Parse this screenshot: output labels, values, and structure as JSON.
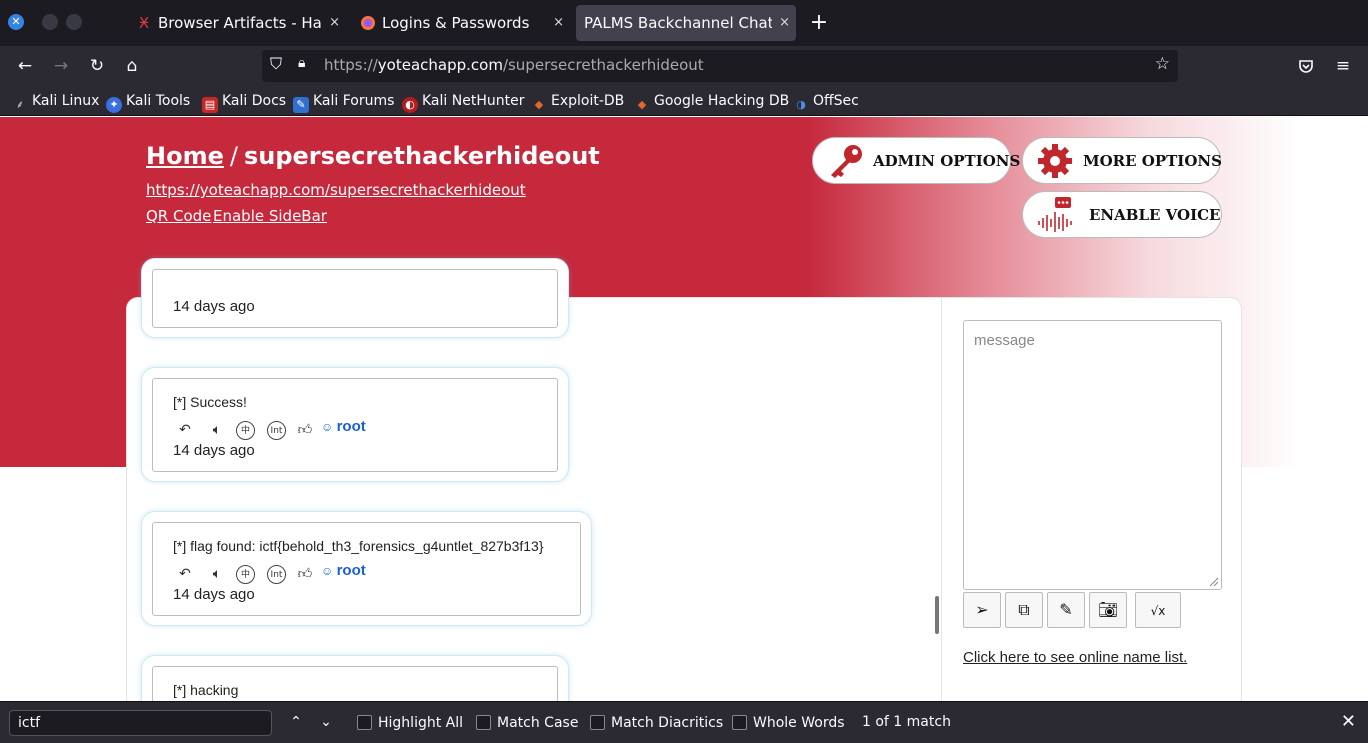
{
  "tabs": [
    {
      "label": "Browser Artifacts - HackT",
      "favicon": "hackthebox-icon",
      "close": "×"
    },
    {
      "label": "Logins & Passwords",
      "favicon": "firefox-icon",
      "close": "×"
    },
    {
      "label": "PALMS Backchannel Chat | Th",
      "favicon": "",
      "close": "×",
      "active": true
    }
  ],
  "urlbar": {
    "scheme": "https://",
    "host": "yoteachapp.com",
    "path": "/supersecrethackerhideout"
  },
  "bookmarks": [
    "Kali Linux",
    "Kali Tools",
    "Kali Docs",
    "Kali Forums",
    "Kali NetHunter",
    "Exploit-DB",
    "Google Hacking DB",
    "OffSec"
  ],
  "header": {
    "home": "Home",
    "separator": "/",
    "room": "supersecrethackerhideout",
    "room_url": "https://yoteachapp.com/supersecrethackerhideout",
    "qr_code": "QR Code",
    "enable_sidebar": "Enable SideBar",
    "admin_options": "ADMIN OPTIONS",
    "more_options": "MORE OPTIONS",
    "enable_voice": "ENABLE VOICE"
  },
  "messages": [
    {
      "text": "",
      "time": "14 days ago",
      "user": ""
    },
    {
      "text": "[*] Success!",
      "time": "14 days ago",
      "user": "root"
    },
    {
      "text": "[*] flag found: ictf{behold_th3_forensics_g4untlet_827b3f13}",
      "time": "14 days ago",
      "user": "root"
    },
    {
      "text": "[*] hacking",
      "time": "",
      "user": ""
    }
  ],
  "message_actions": {
    "circle1": "中",
    "circle2": "Int"
  },
  "composer": {
    "placeholder": "message",
    "online_link": "Click here to see online name list."
  },
  "findbar": {
    "query": "ictf",
    "highlight_all": "Highlight All",
    "match_case": "Match Case",
    "match_diacritics": "Match Diacritics",
    "whole_words": "Whole Words",
    "status": "1 of 1 match"
  },
  "colors": {
    "brand_red": "#c6283c",
    "link_blue": "#1a5fd6",
    "chrome_dark": "#2b2a33"
  }
}
